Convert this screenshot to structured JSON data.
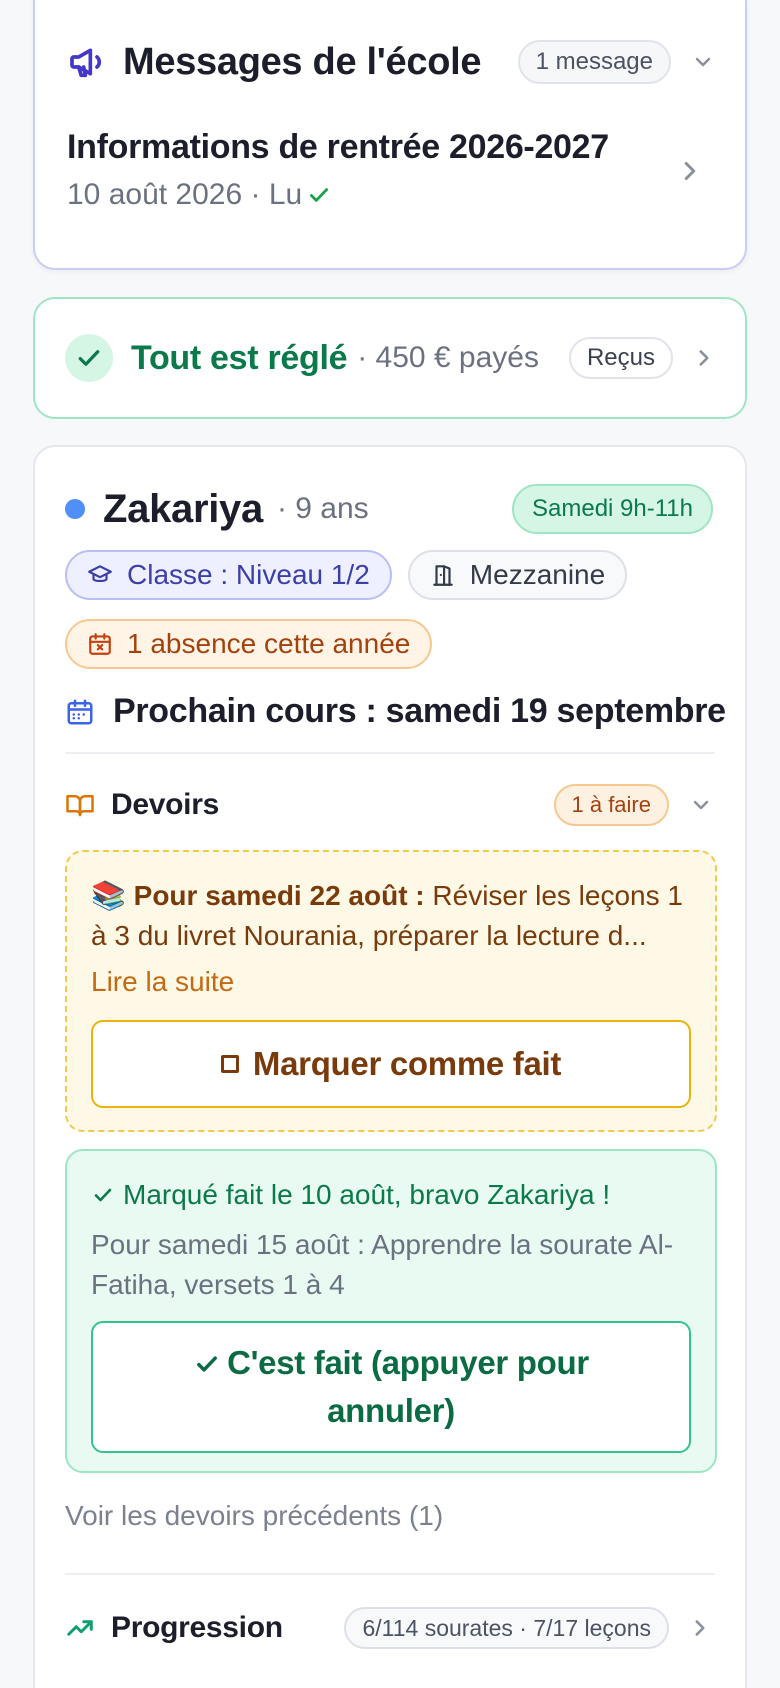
{
  "messages": {
    "title": "Messages de l'école",
    "count_badge": "1 message",
    "item": {
      "title": "Informations de rentrée 2026-2027",
      "meta": "10 août 2026 · Lu"
    }
  },
  "payment": {
    "status": "Tout est réglé",
    "amount": "· 450 € payés",
    "receipts_label": "Reçus"
  },
  "student": {
    "name": "Zakariya",
    "age": "· 9 ans",
    "slot": "Samedi 9h-11h",
    "class_chip": "Classe : Niveau 1/2",
    "room_chip": "Mezzanine",
    "absence_chip": "1 absence cette année",
    "next_course": "Prochain cours : samedi 19 septembre",
    "homework": {
      "title": "Devoirs",
      "todo_badge": "1 à faire",
      "pending": {
        "emoji": "📚",
        "date_label": "Pour samedi 22 août :",
        "text": "Réviser les leçons 1 à 3 du livret Nourania, préparer la lecture d...",
        "read_more": "Lire la suite",
        "mark_button": "Marquer comme fait"
      },
      "done": {
        "status": "Marqué fait le 10 août, bravo Zakariya !",
        "description": "Pour samedi 15 août : Apprendre la sourate Al-Fatiha, versets 1 à 4",
        "undo_button": "C'est fait (appuyer pour annuler)"
      },
      "previous_link": "Voir les devoirs précédents (1)"
    },
    "progress": {
      "title": "Progression",
      "summary": "6/114 sourates · 7/17 leçons"
    }
  },
  "colors": {
    "accent_indigo": "#4338ca",
    "success_green": "#0b7a4a",
    "warning_orange": "#c46a13",
    "student_dot": "#4f8ff7"
  },
  "icons": [
    "megaphone-icon",
    "chevron-down-icon",
    "chevron-right-icon",
    "check-icon",
    "graduation-cap-icon",
    "door-icon",
    "calendar-x-icon",
    "calendar-icon",
    "book-open-icon",
    "trending-up-icon",
    "books-emoji-icon",
    "checkbox-icon"
  ]
}
